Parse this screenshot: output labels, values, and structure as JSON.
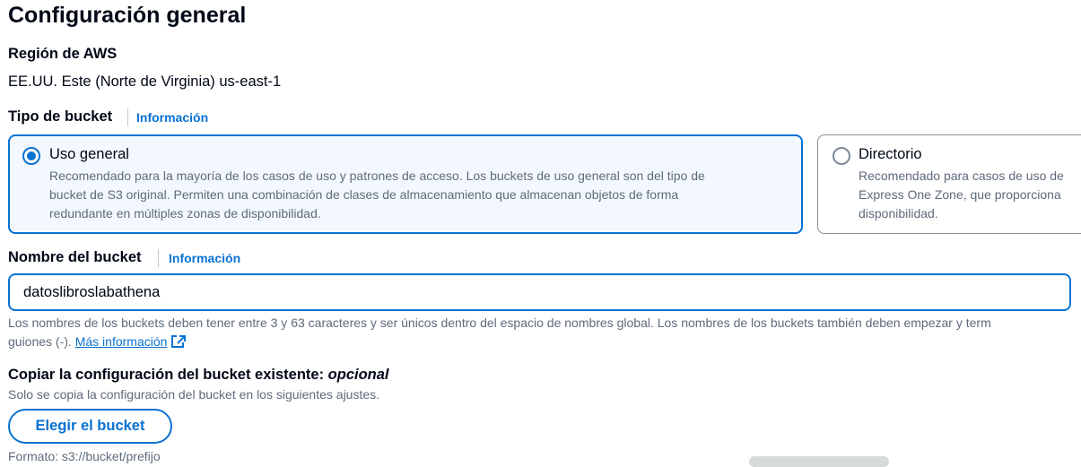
{
  "section": {
    "title": "Configuración general"
  },
  "region": {
    "label": "Región de AWS",
    "value": "EE.UU. Este (Norte de Virginia) us-east-1"
  },
  "bucket_type": {
    "label": "Tipo de bucket",
    "info_link": "Información",
    "options": [
      {
        "title": "Uso general",
        "selected": true,
        "desc_lines": [
          "Recomendado para la mayoría de los casos de uso y patrones de acceso. Los buckets de uso general son del tipo de",
          "bucket de S3 original. Permiten una combinación de clases de almacenamiento que almacenan objetos de forma",
          "redundante en múltiples zonas de disponibilidad."
        ]
      },
      {
        "title": "Directorio",
        "selected": false,
        "desc_lines": [
          "Recomendado para casos de uso de",
          "Express One Zone, que proporciona",
          "disponibilidad."
        ]
      }
    ]
  },
  "bucket_name": {
    "label": "Nombre del bucket",
    "info_link": "Información",
    "value": "datoslibroslabathena",
    "hint_line1": "Los nombres de los buckets deben tener entre 3 y 63 caracteres y ser únicos dentro del espacio de nombres global. Los nombres de los buckets también deben empezar y term",
    "hint_line2": "guiones (-).",
    "more_link": "Más información"
  },
  "copy_config": {
    "label": "Copiar la configuración del bucket existente:",
    "optional": "opcional",
    "description": "Solo se copia la configuración del bucket en los siguientes ajustes.",
    "button": "Elegir el bucket",
    "format": "Formato: s3://bucket/prefijo"
  },
  "colors": {
    "accent": "#0972d3",
    "selected_bg": "#f2f8fd",
    "muted_text": "#5f6b7a",
    "text": "#000716"
  },
  "icons": {
    "selected_radio": "radio-selected-icon",
    "unselected_radio": "radio-unselected-icon",
    "external": "external-link-icon"
  }
}
